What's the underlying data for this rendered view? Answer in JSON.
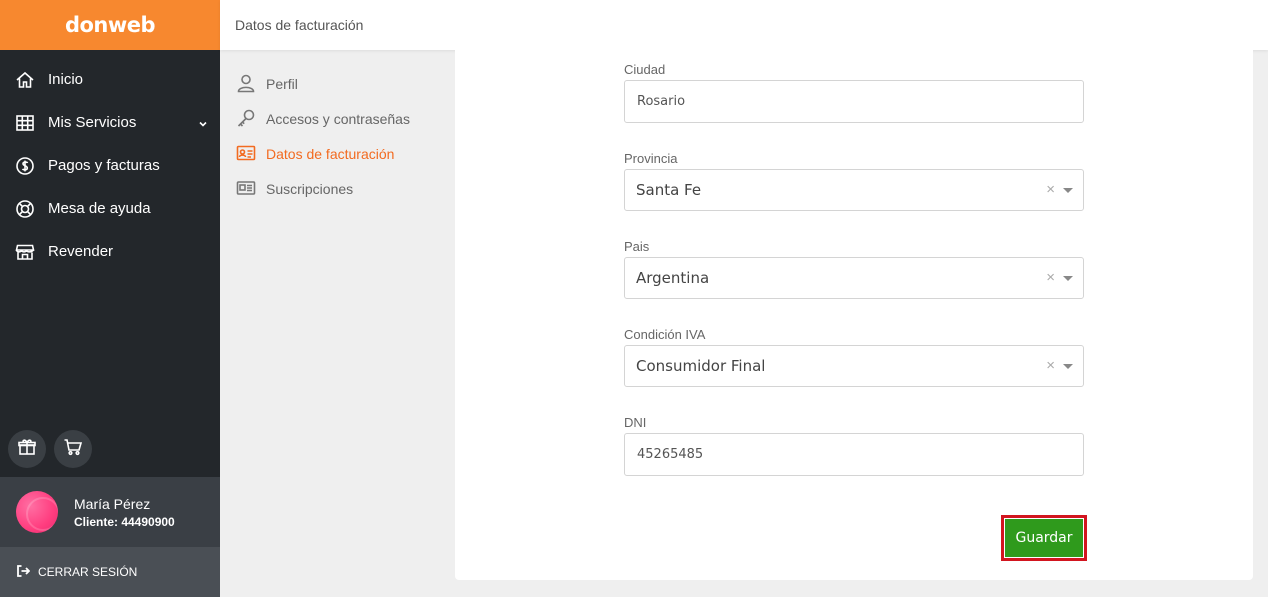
{
  "brand": "donweb",
  "header": {
    "title": "Datos de facturación"
  },
  "sidebar": {
    "items": [
      {
        "label": "Inicio",
        "icon": "home-icon"
      },
      {
        "label": "Mis Servicios",
        "icon": "grid-icon",
        "expandable": true
      },
      {
        "label": "Pagos y facturas",
        "icon": "dollar-circle-icon"
      },
      {
        "label": "Mesa de ayuda",
        "icon": "lifebuoy-icon"
      },
      {
        "label": "Revender",
        "icon": "store-icon"
      }
    ],
    "quick_actions": [
      "gift-icon",
      "cart-icon"
    ]
  },
  "user": {
    "name": "María Pérez",
    "client": "Cliente: 44490900"
  },
  "logout": {
    "label": "CERRAR SESIÓN"
  },
  "subnav": {
    "items": [
      {
        "label": "Perfil",
        "icon": "user-icon",
        "active": false
      },
      {
        "label": "Accesos y contraseñas",
        "icon": "key-icon",
        "active": false
      },
      {
        "label": "Datos de facturación",
        "icon": "id-card-icon",
        "active": true
      },
      {
        "label": "Suscripciones",
        "icon": "newspaper-icon",
        "active": false
      }
    ]
  },
  "form": {
    "ciudad": {
      "label": "Ciudad",
      "value": "Rosario"
    },
    "provincia": {
      "label": "Provincia",
      "value": "Santa Fe"
    },
    "pais": {
      "label": "Pais",
      "value": "Argentina"
    },
    "condicion_iva": {
      "label": "Condición IVA",
      "value": "Consumidor Final"
    },
    "dni": {
      "label": "DNI",
      "value": "45265485"
    },
    "save_label": "Guardar",
    "clear_glyph": "×"
  },
  "colors": {
    "brand": "#f7882f",
    "sidebar": "#23272b",
    "active": "#f26b21",
    "save": "#2f9a1c",
    "highlight": "#d2151f"
  }
}
